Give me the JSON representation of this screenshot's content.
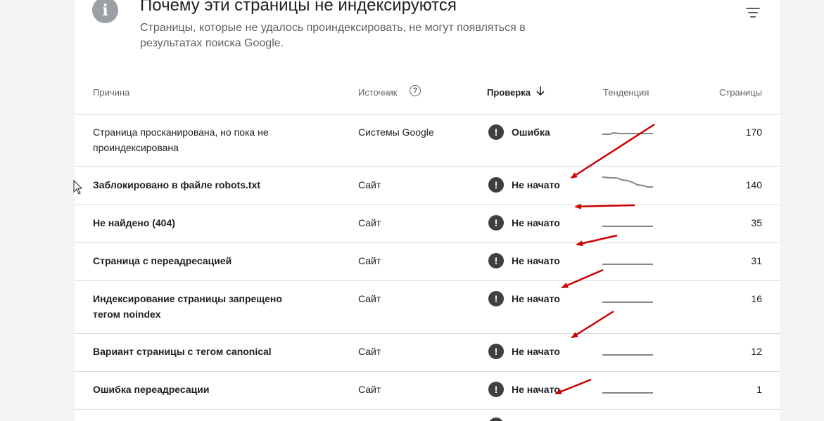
{
  "header": {
    "info_icon": "info-icon",
    "title": "Почему эти страницы не индексируются",
    "subtitle": "Страницы, которые не удалось проиндексировать, не могут появляться в результатах поиска Google.",
    "filter_icon": "filter-icon"
  },
  "table": {
    "columns": {
      "reason": "Причина",
      "source": "Источник",
      "check": "Проверка",
      "trend": "Тенденция",
      "pages": "Страницы"
    },
    "rows": [
      {
        "reason": "Страница просканирована, но пока не проиндексирована",
        "source": "Системы Google",
        "status": "Ошибка",
        "pages": "170"
      },
      {
        "reason": "Заблокировано в файле robots.txt",
        "source": "Сайт",
        "status": "Не начато",
        "pages": "140"
      },
      {
        "reason": "Не найдено (404)",
        "source": "Сайт",
        "status": "Не начато",
        "pages": "35"
      },
      {
        "reason": "Страница с переадресацией",
        "source": "Сайт",
        "status": "Не начато",
        "pages": "31"
      },
      {
        "reason": "Индексирование страницы запрещено тегом noindex",
        "source": "Сайт",
        "status": "Не начато",
        "pages": "16"
      },
      {
        "reason": "Вариант страницы с тегом canonical",
        "source": "Сайт",
        "status": "Не начато",
        "pages": "12"
      },
      {
        "reason": "Ошибка переадресации",
        "source": "Сайт",
        "status": "Не начато",
        "pages": "1"
      }
    ]
  },
  "colors": {
    "annotation_arrow": "#cc0000",
    "status_icon": "#3c4043",
    "sparkline": "#80868b"
  }
}
